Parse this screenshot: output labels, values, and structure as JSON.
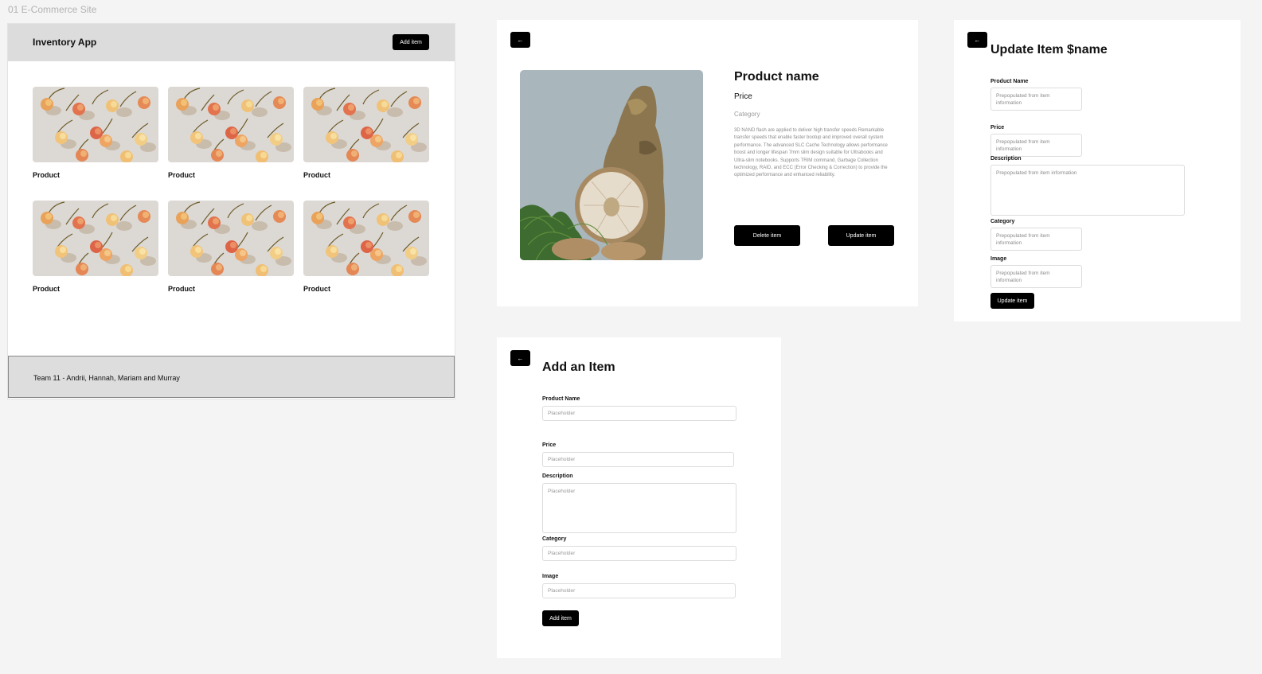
{
  "canvas": {
    "label": "01 E-Commerce Site"
  },
  "inventory": {
    "app_title": "Inventory App",
    "add_button": "Add item",
    "products": [
      {
        "label": "Product"
      },
      {
        "label": "Product"
      },
      {
        "label": "Product"
      },
      {
        "label": "Product"
      },
      {
        "label": "Product"
      },
      {
        "label": "Product"
      }
    ],
    "footer": "Team 11 - Andrii, Hannah, Mariam and Murray"
  },
  "detail": {
    "back_icon": "arrow-left-icon",
    "name": "Product name",
    "price": "Price",
    "category": "Category",
    "description": "3D NAND flash are applied to deliver high transfer speeds Remarkable transfer speeds that enable faster bootup and improved overall system performance. The advanced SLC Cache Technology allows performance boost and longer lifespan 7mm slim design suitable for Ultrabooks and Ultra-slim notebooks. Supports TRIM command, Garbage Collection technology, RAID, and ECC (Error Checking & Correction) to provide the optimized performance and enhanced reliability.",
    "delete_button": "Delete item",
    "update_button": "Update item"
  },
  "update": {
    "back_icon": "arrow-left-icon",
    "title": "Update Item $name",
    "fields": {
      "product_name": {
        "label": "Product Name",
        "placeholder": "Prepopulated from item information"
      },
      "price": {
        "label": "Price",
        "placeholder": "Prepopulated from item information"
      },
      "description": {
        "label": "Description",
        "placeholder": "Prepopulated from item information"
      },
      "category": {
        "label": "Category",
        "placeholder": "Prepopulated from item information"
      },
      "image": {
        "label": "Image",
        "placeholder": "Prepopulated from item information"
      }
    },
    "submit_button": "Update item"
  },
  "add": {
    "back_icon": "arrow-left-icon",
    "title": "Add an Item",
    "fields": {
      "product_name": {
        "label": "Product Name",
        "placeholder": "Placeholder"
      },
      "price": {
        "label": "Price",
        "placeholder": "Placeholder"
      },
      "description": {
        "label": "Description",
        "placeholder": "Placeholder"
      },
      "category": {
        "label": "Category",
        "placeholder": "Placeholder"
      },
      "image": {
        "label": "Image",
        "placeholder": "Placeholder"
      }
    },
    "submit_button": "Add item"
  }
}
